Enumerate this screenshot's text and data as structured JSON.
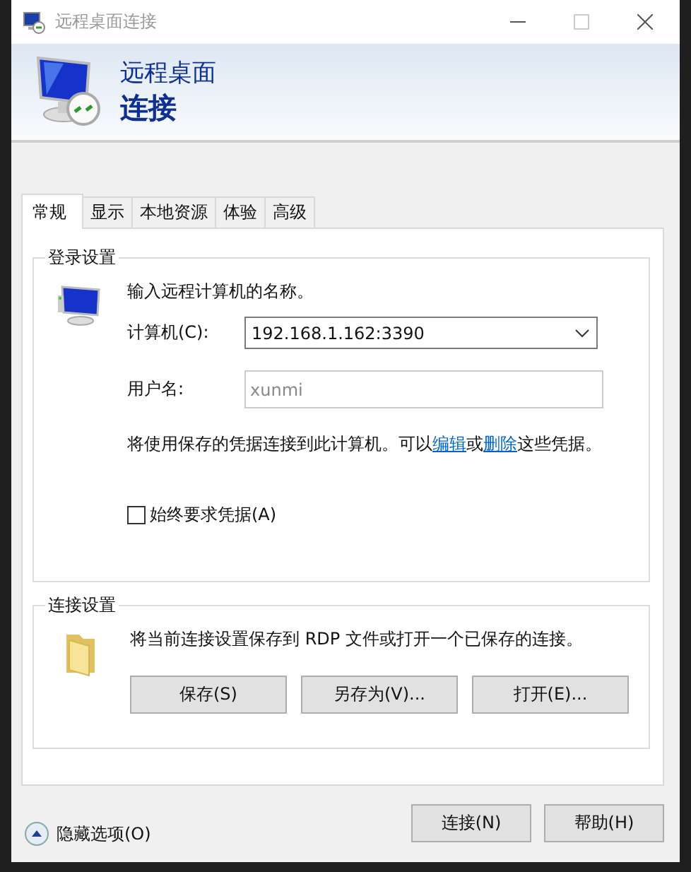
{
  "window": {
    "title": "远程桌面连接"
  },
  "banner": {
    "line_1": "远程桌面",
    "line_2": "连接"
  },
  "tabs": [
    {
      "label": "常规",
      "selected": true
    },
    {
      "label": "显示",
      "selected": false
    },
    {
      "label": "本地资源",
      "selected": false
    },
    {
      "label": "体验",
      "selected": false
    },
    {
      "label": "高级",
      "selected": false
    }
  ],
  "login_settings": {
    "title": "登录设置",
    "prompt": "输入远程计算机的名称。",
    "computer": {
      "label": "计算机(C):",
      "value": "192.168.1.162:3390"
    },
    "username": {
      "label": "用户名:",
      "value": "xunmi",
      "disabled": true
    },
    "note": {
      "before": "将使用保存的凭据连接到此计算机。可以",
      "link_edit": "编辑",
      "middle": "或",
      "link_delete": "删除",
      "after": "这些凭据。"
    },
    "always_ask": {
      "label": "始终要求凭据(A)",
      "checked": false
    }
  },
  "connection_settings": {
    "title": "连接设置",
    "description": "将当前连接设置保存到 RDP 文件或打开一个已保存的连接。",
    "buttons": [
      "保存(S)",
      "另存为(V)...",
      "打开(E)..."
    ]
  },
  "footer": {
    "toggle": "隐藏选项(O)",
    "buttons": [
      "连接(N)",
      "帮助(H)"
    ]
  }
}
